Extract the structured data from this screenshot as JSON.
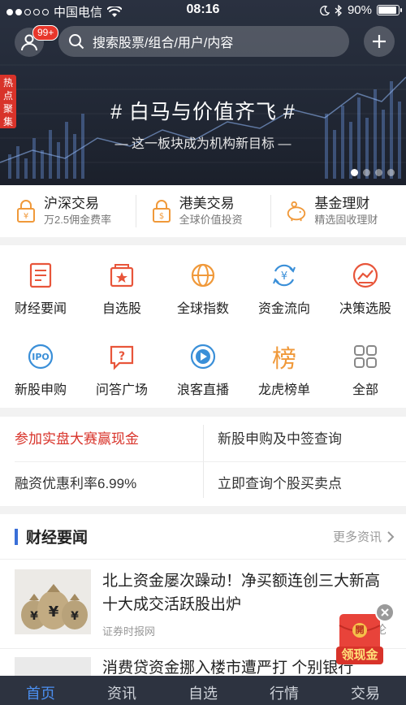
{
  "status_bar": {
    "carrier": "中国电信",
    "time": "08:16",
    "battery": "90%"
  },
  "header": {
    "badge": "99+",
    "search_placeholder": "搜索股票/组合/用户/内容"
  },
  "banner": {
    "tag": "热点聚集",
    "title": "# 白马与价值齐飞 #",
    "subtitle": "— 这一板块成为机构新目标 —",
    "page_count": 4,
    "active_page": 1
  },
  "trade": [
    {
      "title": "沪深交易",
      "sub": "万2.5佣金费率",
      "icon": "lock-yen-icon"
    },
    {
      "title": "港美交易",
      "sub": "全球价值投资",
      "icon": "lock-dollar-icon"
    },
    {
      "title": "基金理财",
      "sub": "精选固收理财",
      "icon": "piggy-bank-icon"
    }
  ],
  "grid": [
    {
      "label": "财经要闻",
      "icon": "news-doc-icon"
    },
    {
      "label": "自选股",
      "icon": "watchlist-icon"
    },
    {
      "label": "全球指数",
      "icon": "globe-icon"
    },
    {
      "label": "资金流向",
      "icon": "yen-cycle-icon"
    },
    {
      "label": "决策选股",
      "icon": "trend-chart-icon"
    },
    {
      "label": "新股申购",
      "icon": "ipo-icon"
    },
    {
      "label": "问答广场",
      "icon": "question-bubble-icon"
    },
    {
      "label": "浪客直播",
      "icon": "play-icon"
    },
    {
      "label": "龙虎榜单",
      "icon": "bang-char-icon"
    },
    {
      "label": "全部",
      "icon": "grid-all-icon"
    }
  ],
  "grid_icon_glyph": "榜",
  "links": {
    "promo": "参加实盘大赛赢现金",
    "ipo_query": "新股申购及中签查询",
    "margin_rate": "融资优惠利率6.99%",
    "stock_query": "立即查询个股买卖点"
  },
  "news": {
    "section_title": "财经要闻",
    "more": "更多资讯",
    "articles": [
      {
        "title": "北上资金屡次躁动！净买额连创三大新高 十大成交活跃股出炉",
        "source": "证券时报网",
        "extra": "论"
      },
      {
        "title": "消费贷资金挪入楼市遭严打 个别银行"
      }
    ]
  },
  "red_packet": {
    "glyph": "開",
    "label": "领现金"
  },
  "tabbar": {
    "tabs": [
      "首页",
      "资讯",
      "自选",
      "行情",
      "交易"
    ],
    "active": 0
  },
  "colors": {
    "accent_red": "#d8332a",
    "accent_blue": "#3a6fd8",
    "icon_orange": "#f0993a",
    "tabbar_bg": "#2d3340",
    "tab_active": "#4b8ff0"
  }
}
